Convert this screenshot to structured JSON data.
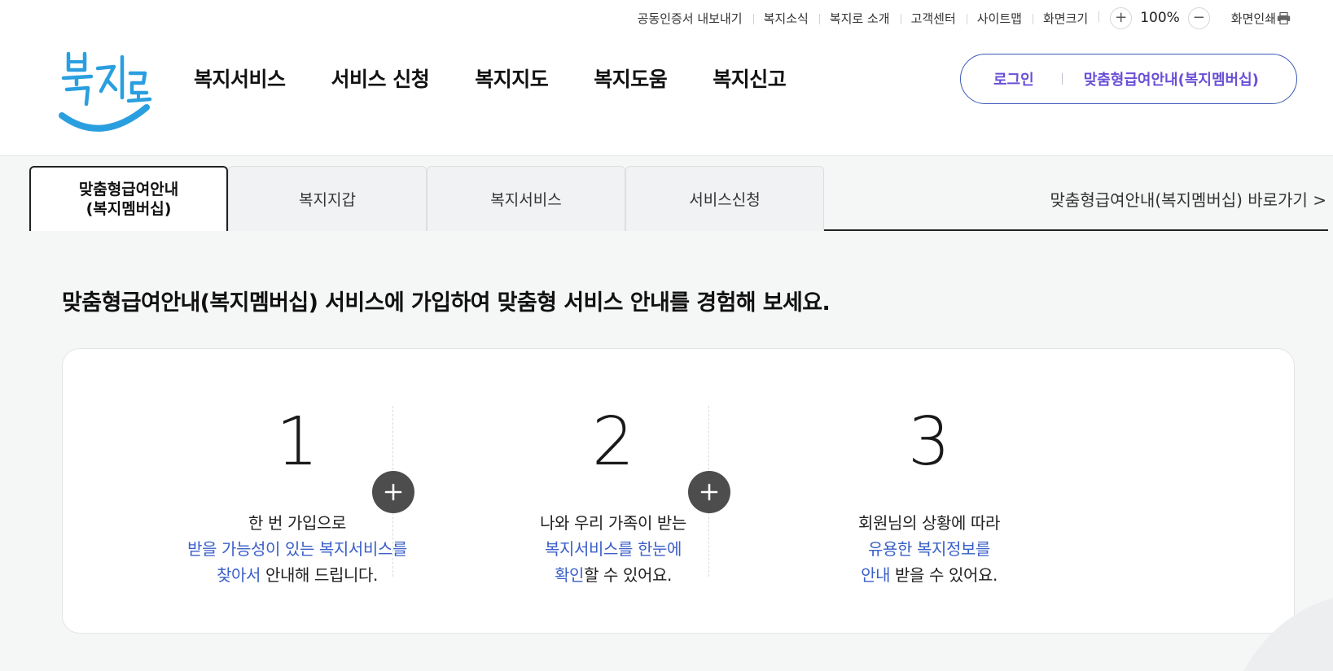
{
  "util": {
    "links": [
      "공동인증서 내보내기",
      "복지소식",
      "복지로 소개",
      "고객센터",
      "사이트맵",
      "화면크기"
    ],
    "zoom_in": "+",
    "zoom_value": "100%",
    "zoom_out": "−",
    "print_label": "화면인쇄"
  },
  "logo": {
    "text": "복지로",
    "color": "#2a9fe0"
  },
  "gnb": [
    "복지서비스",
    "서비스 신청",
    "복지지도",
    "복지도움",
    "복지신고"
  ],
  "member": {
    "login": "로그인",
    "membership": "맞춤형급여안내(복지멤버십)"
  },
  "tabs": {
    "active_line1": "맞춤형급여안내",
    "active_line2": "(복지멤버십)",
    "items": [
      "복지지갑",
      "복지서비스",
      "서비스신청"
    ],
    "shortcut": "맞춤형급여안내(복지멤버십) 바로가기 >"
  },
  "lead": "맞춤형급여안내(복지멤버십) 서비스에 가입하여 맞춤형 서비스 안내를 경험해 보세요.",
  "steps": [
    {
      "num": "1",
      "line1": "한 번 가입으로",
      "line2_hl": "받을 가능성이 있는 복지서비스를",
      "line3_hl": "찾아서",
      "line3_rest": " 안내해 드립니다."
    },
    {
      "num": "2",
      "line1": "나와 우리 가족이 받는",
      "line2_hl": "복지서비스를 한눈에",
      "line3_hl": "확인",
      "line3_rest": "할 수 있어요."
    },
    {
      "num": "3",
      "line1": "회원님의 상황에 따라",
      "line2_hl": "유용한 복지정보를",
      "line3_hl": "안내",
      "line3_rest": " 받을 수 있어요."
    }
  ],
  "colors": {
    "accent_blue": "#3a5fc8",
    "member_purple": "#6a4fd6",
    "border_blue": "#3a58b7"
  }
}
